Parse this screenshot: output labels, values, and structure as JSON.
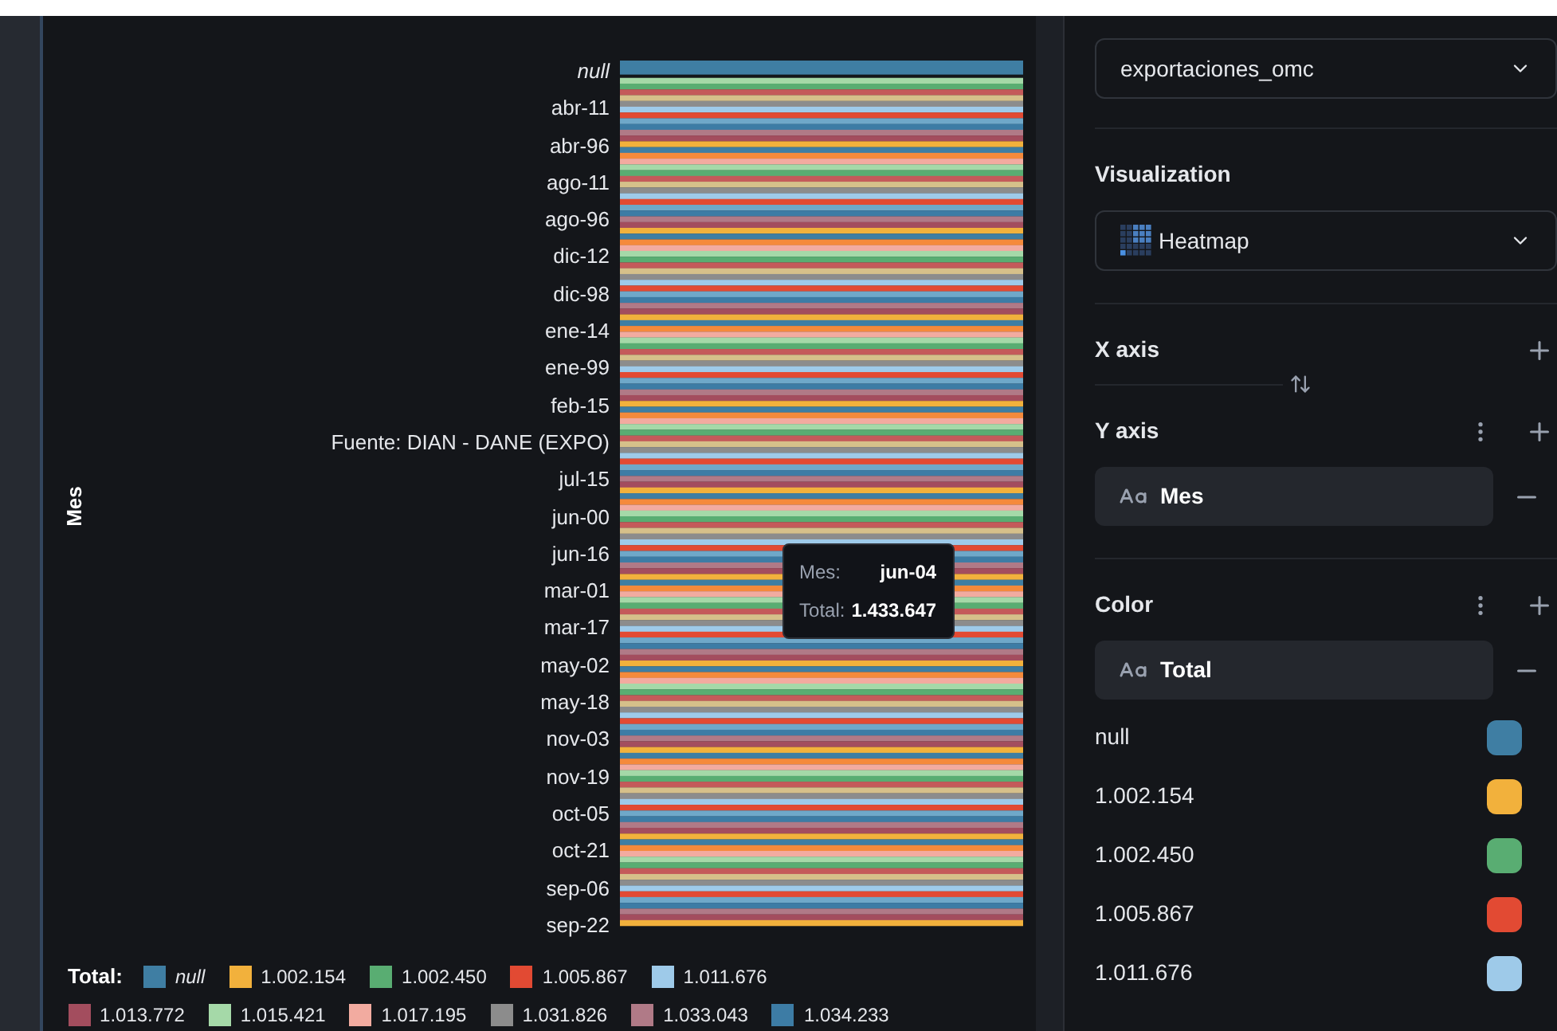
{
  "chart": {
    "y_axis_title": "Mes",
    "y_labels": [
      {
        "label": "null",
        "italic": true
      },
      {
        "label": "abr-11",
        "italic": false
      },
      {
        "label": "abr-96",
        "italic": false
      },
      {
        "label": "ago-11",
        "italic": false
      },
      {
        "label": "ago-96",
        "italic": false
      },
      {
        "label": "dic-12",
        "italic": false
      },
      {
        "label": "dic-98",
        "italic": false
      },
      {
        "label": "ene-14",
        "italic": false
      },
      {
        "label": "ene-99",
        "italic": false
      },
      {
        "label": "feb-15",
        "italic": false
      },
      {
        "label": "Fuente: DIAN - DANE (EXPO)",
        "italic": false
      },
      {
        "label": "jul-15",
        "italic": false
      },
      {
        "label": "jun-00",
        "italic": false
      },
      {
        "label": "jun-16",
        "italic": false
      },
      {
        "label": "mar-01",
        "italic": false
      },
      {
        "label": "mar-17",
        "italic": false
      },
      {
        "label": "may-02",
        "italic": false
      },
      {
        "label": "may-18",
        "italic": false
      },
      {
        "label": "nov-03",
        "italic": false
      },
      {
        "label": "nov-19",
        "italic": false
      },
      {
        "label": "oct-05",
        "italic": false
      },
      {
        "label": "oct-21",
        "italic": false
      },
      {
        "label": "sep-06",
        "italic": false
      },
      {
        "label": "sep-22",
        "italic": false
      }
    ],
    "tooltip": [
      {
        "label": "Mes:",
        "value": "jun-04"
      },
      {
        "label": "Total:",
        "value": "1.433.647"
      }
    ],
    "legend": {
      "title": "Total:",
      "items": [
        {
          "label": "null",
          "italic": true,
          "color": "#3f7ea3"
        },
        {
          "label": "1.002.154",
          "italic": false,
          "color": "#f2b13c"
        },
        {
          "label": "1.002.450",
          "italic": false,
          "color": "#59ad72"
        },
        {
          "label": "1.005.867",
          "italic": false,
          "color": "#e24a33"
        },
        {
          "label": "1.011.676",
          "italic": false,
          "color": "#9ecae9"
        },
        {
          "label": "1.013.772",
          "italic": false,
          "color": "#a34d5e"
        },
        {
          "label": "1.015.421",
          "italic": false,
          "color": "#a5d9a8"
        },
        {
          "label": "1.017.195",
          "italic": false,
          "color": "#f2aba0"
        },
        {
          "label": "1.031.826",
          "italic": false,
          "color": "#8c8c8c"
        },
        {
          "label": "1.033.043",
          "italic": false,
          "color": "#b07a87"
        },
        {
          "label": "1.034.233",
          "italic": false,
          "color": "#3d7ca5"
        }
      ]
    }
  },
  "panel": {
    "dataset": "exportaciones_omc",
    "visualization_label": "Visualization",
    "visualization": "Heatmap",
    "x_axis": {
      "label": "X axis"
    },
    "y_axis": {
      "label": "Y axis",
      "field": "Mes"
    },
    "color": {
      "label": "Color",
      "field": "Total",
      "items": [
        {
          "label": "null",
          "color": "#3f7ea3"
        },
        {
          "label": "1.002.154",
          "color": "#f2b13c"
        },
        {
          "label": "1.002.450",
          "color": "#59ad72"
        },
        {
          "label": "1.005.867",
          "color": "#e24a33"
        },
        {
          "label": "1.011.676",
          "color": "#9ecae9"
        }
      ]
    }
  }
}
